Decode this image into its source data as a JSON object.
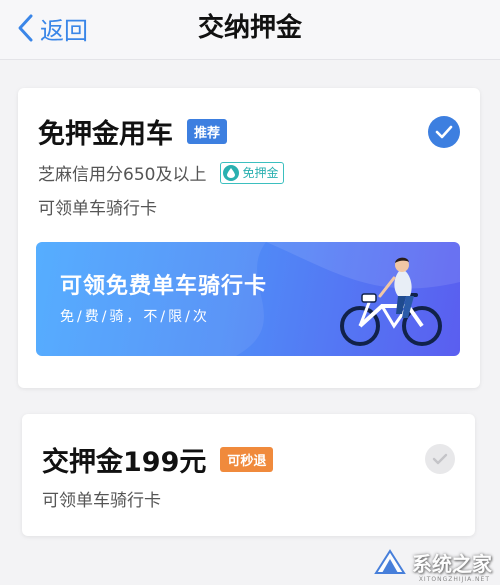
{
  "header": {
    "back_label": "返回",
    "title": "交纳押金"
  },
  "options": {
    "free": {
      "title": "免押金用车",
      "badge": "推荐",
      "line1": "芝麻信用分650及以上",
      "tag": "免押金",
      "line2": "可领单车骑行卡",
      "selected": true,
      "banner_title": "可领免费单车骑行卡",
      "banner_sub": "免/费/骑，不/限/次"
    },
    "deposit": {
      "title": "交押金199元",
      "badge": "可秒退",
      "line1": "可领单车骑行卡",
      "selected": false
    }
  },
  "watermark": {
    "text": "系统之家",
    "sub": "XITONGZHIJIA.NET"
  },
  "colors": {
    "accent": "#3d7fe0",
    "orange": "#f08a3c",
    "teal": "#2ab0b0"
  }
}
